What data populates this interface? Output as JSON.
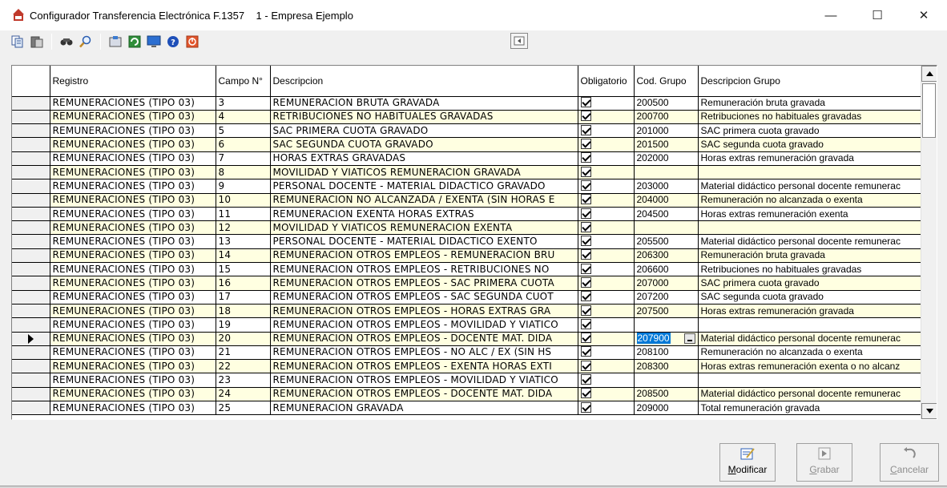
{
  "window": {
    "title": "Configurador Transferencia Electrónica F.1357    1 - Empresa Ejemplo",
    "minimize": "—",
    "maximize": "☐",
    "close": "✕"
  },
  "grid": {
    "columns": [
      "Registro",
      "Campo N°",
      "Descripcion",
      "Obligatorio",
      "Cod. Grupo",
      "Descripcion Grupo"
    ],
    "current_row_index": 17,
    "rows": [
      {
        "registro": "REMUNERACIONES (TIPO 03)",
        "campo": "3",
        "descripcion": "REMUNERACION BRUTA GRAVADA",
        "obligatorio": true,
        "cod": "200500",
        "grupo": "Remuneración bruta gravada"
      },
      {
        "registro": "REMUNERACIONES (TIPO 03)",
        "campo": "4",
        "descripcion": "RETRIBUCIONES NO HABITUALES GRAVADAS",
        "obligatorio": true,
        "cod": "200700",
        "grupo": "Retribuciones no habituales gravadas"
      },
      {
        "registro": "REMUNERACIONES (TIPO 03)",
        "campo": "5",
        "descripcion": "SAC PRIMERA CUOTA GRAVADO",
        "obligatorio": true,
        "cod": "201000",
        "grupo": "SAC primera cuota gravado"
      },
      {
        "registro": "REMUNERACIONES (TIPO 03)",
        "campo": "6",
        "descripcion": "SAC SEGUNDA CUOTA GRAVADO",
        "obligatorio": true,
        "cod": "201500",
        "grupo": "SAC segunda cuota gravado"
      },
      {
        "registro": "REMUNERACIONES (TIPO 03)",
        "campo": "7",
        "descripcion": "HORAS EXTRAS GRAVADAS",
        "obligatorio": true,
        "cod": "202000",
        "grupo": "Horas extras remuneración gravada"
      },
      {
        "registro": "REMUNERACIONES (TIPO 03)",
        "campo": "8",
        "descripcion": "MOVILIDAD Y VIATICOS REMUNERACION GRAVADA",
        "obligatorio": true,
        "cod": "",
        "grupo": ""
      },
      {
        "registro": "REMUNERACIONES (TIPO 03)",
        "campo": "9",
        "descripcion": "PERSONAL DOCENTE - MATERIAL DIDACTICO GRAVADO",
        "obligatorio": true,
        "cod": "203000",
        "grupo": "Material didáctico personal docente remunerac"
      },
      {
        "registro": "REMUNERACIONES (TIPO 03)",
        "campo": "10",
        "descripcion": "REMUNERACION NO ALCANZADA / EXENTA (SIN HORAS E",
        "obligatorio": true,
        "cod": "204000",
        "grupo": "Remuneración no alcanzada o exenta"
      },
      {
        "registro": "REMUNERACIONES (TIPO 03)",
        "campo": "11",
        "descripcion": "REMUNERACION EXENTA HORAS EXTRAS",
        "obligatorio": true,
        "cod": "204500",
        "grupo": "Horas extras remuneración exenta"
      },
      {
        "registro": "REMUNERACIONES (TIPO 03)",
        "campo": "12",
        "descripcion": "MOVILIDAD Y VIATICOS REMUNERACION EXENTA",
        "obligatorio": true,
        "cod": "",
        "grupo": ""
      },
      {
        "registro": "REMUNERACIONES (TIPO 03)",
        "campo": "13",
        "descripcion": "PERSONAL DOCENTE - MATERIAL DIDACTICO EXENTO",
        "obligatorio": true,
        "cod": "205500",
        "grupo": "Material didáctico personal docente remunerac"
      },
      {
        "registro": "REMUNERACIONES (TIPO 03)",
        "campo": "14",
        "descripcion": "REMUNERACION OTROS EMPLEOS - REMUNERACION BRU",
        "obligatorio": true,
        "cod": "206300",
        "grupo": "Remuneración bruta gravada"
      },
      {
        "registro": "REMUNERACIONES (TIPO 03)",
        "campo": "15",
        "descripcion": "REMUNERACION OTROS EMPLEOS - RETRIBUCIONES NO",
        "obligatorio": true,
        "cod": "206600",
        "grupo": "Retribuciones no habituales gravadas"
      },
      {
        "registro": "REMUNERACIONES (TIPO 03)",
        "campo": "16",
        "descripcion": "REMUNERACION OTROS EMPLEOS - SAC PRIMERA CUOTA",
        "obligatorio": true,
        "cod": "207000",
        "grupo": "SAC primera cuota gravado"
      },
      {
        "registro": "REMUNERACIONES (TIPO 03)",
        "campo": "17",
        "descripcion": "REMUNERACION OTROS EMPLEOS - SAC SEGUNDA CUOT",
        "obligatorio": true,
        "cod": "207200",
        "grupo": "SAC segunda cuota gravado"
      },
      {
        "registro": "REMUNERACIONES (TIPO 03)",
        "campo": "18",
        "descripcion": "REMUNERACION OTROS EMPLEOS - HORAS EXTRAS GRA",
        "obligatorio": true,
        "cod": "207500",
        "grupo": "Horas extras remuneración gravada"
      },
      {
        "registro": "REMUNERACIONES (TIPO 03)",
        "campo": "19",
        "descripcion": "REMUNERACION OTROS EMPLEOS - MOVILIDAD Y VIATICO",
        "obligatorio": true,
        "cod": "",
        "grupo": ""
      },
      {
        "registro": "REMUNERACIONES (TIPO 03)",
        "campo": "20",
        "descripcion": "REMUNERACION OTROS EMPLEOS - DOCENTE MAT. DIDA",
        "obligatorio": true,
        "cod": "207900",
        "grupo": "Material didáctico personal docente remunerac"
      },
      {
        "registro": "REMUNERACIONES (TIPO 03)",
        "campo": "21",
        "descripcion": "REMUNERACION OTROS EMPLEOS - NO ALC / EX (SIN HS",
        "obligatorio": true,
        "cod": "208100",
        "grupo": "Remuneración no alcanzada o exenta"
      },
      {
        "registro": "REMUNERACIONES (TIPO 03)",
        "campo": "22",
        "descripcion": "REMUNERACION OTROS EMPLEOS - EXENTA HORAS EXTI",
        "obligatorio": true,
        "cod": "208300",
        "grupo": "Horas extras remuneración exenta o no alcanz"
      },
      {
        "registro": "REMUNERACIONES (TIPO 03)",
        "campo": "23",
        "descripcion": "REMUNERACION OTROS EMPLEOS - MOVILIDAD Y VIATICO",
        "obligatorio": true,
        "cod": "",
        "grupo": ""
      },
      {
        "registro": "REMUNERACIONES (TIPO 03)",
        "campo": "24",
        "descripcion": "REMUNERACION OTROS EMPLEOS - DOCENTE MAT. DIDA",
        "obligatorio": true,
        "cod": "208500",
        "grupo": "Material didáctico personal docente remunerac"
      },
      {
        "registro": "REMUNERACIONES (TIPO 03)",
        "campo": "25",
        "descripcion": "REMUNERACION GRAVADA",
        "obligatorio": true,
        "cod": "209000",
        "grupo": "Total remuneración gravada"
      }
    ]
  },
  "buttons": {
    "modificar": "Modificar",
    "grabar": "Grabar",
    "cancelar": "Cancelar"
  },
  "colors": {
    "alt_row": "#ffffe1",
    "selection": "#0078d7"
  }
}
